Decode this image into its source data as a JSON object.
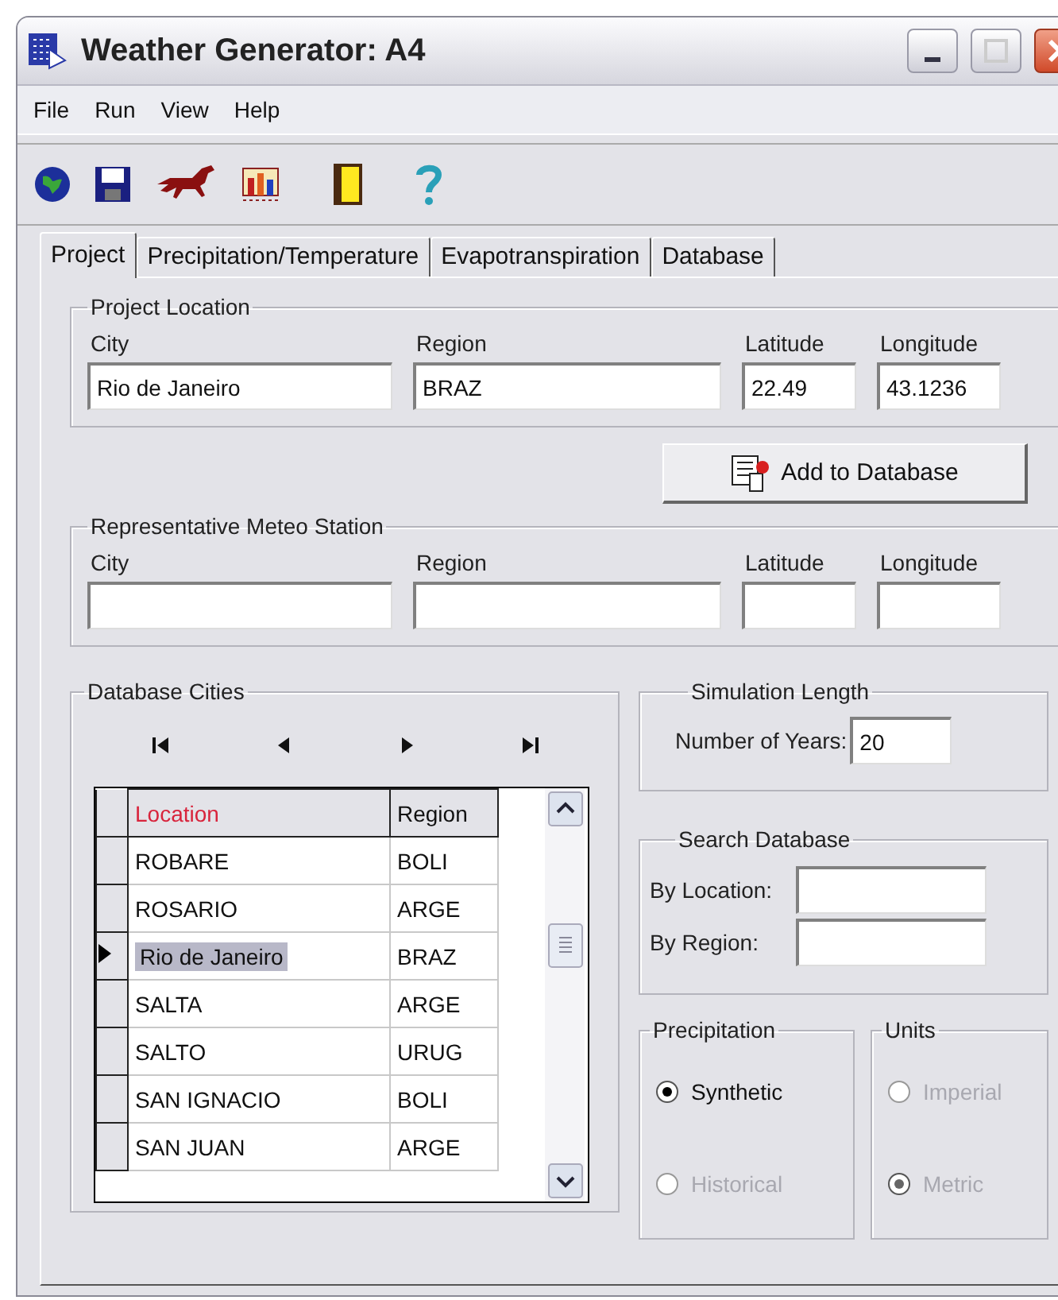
{
  "window": {
    "title": "Weather Generator: A4"
  },
  "menu": [
    "File",
    "Run",
    "View",
    "Help"
  ],
  "tabs": [
    {
      "label": "Project",
      "selected": true
    },
    {
      "label": "Precipitation/Temperature",
      "selected": false
    },
    {
      "label": "Evapotranspiration",
      "selected": false
    },
    {
      "label": "Database",
      "selected": false
    }
  ],
  "project_location": {
    "title": "Project Location",
    "fields": [
      {
        "label": "City",
        "value": "Rio de Janeiro"
      },
      {
        "label": "Region",
        "value": "BRAZ"
      },
      {
        "label": "Latitude",
        "value": "22.49"
      },
      {
        "label": "Longitude",
        "value": "43.1236"
      }
    ]
  },
  "add_button": "Add to Database",
  "meteo_station": {
    "title": "Representative Meteo Station",
    "fields": [
      {
        "label": "City"
      },
      {
        "label": "Region"
      },
      {
        "label": "Latitude"
      },
      {
        "label": "Longitude"
      }
    ]
  },
  "database_cities": {
    "title": "Database Cities",
    "columns": [
      {
        "label": "Location",
        "sorted": true
      },
      {
        "label": "Region",
        "sorted": false
      }
    ],
    "rows": [
      {
        "cells": [
          "ROBARE",
          "BOLI"
        ],
        "selected": false
      },
      {
        "cells": [
          "ROSARIO",
          "ARGE"
        ],
        "selected": false
      },
      {
        "cells": [
          "Rio de Janeiro",
          "BRAZ"
        ],
        "selected": true
      },
      {
        "cells": [
          "SALTA",
          "ARGE"
        ],
        "selected": false
      },
      {
        "cells": [
          "SALTO",
          "URUG"
        ],
        "selected": false
      },
      {
        "cells": [
          "SAN IGNACIO",
          "BOLI"
        ],
        "selected": false
      },
      {
        "cells": [
          "SAN JUAN",
          "ARGE"
        ],
        "selected": false
      }
    ]
  },
  "simulation_length": {
    "title": "Simulation Length",
    "label": "Number of Years:",
    "value": "20"
  },
  "search_database": {
    "title": "Search Database",
    "fields": [
      {
        "label": "By Location:"
      },
      {
        "label": "By Region:"
      }
    ]
  },
  "precipitation": {
    "title": "Precipitation",
    "options": [
      {
        "label": "Synthetic",
        "selected": true,
        "disabled": false
      },
      {
        "label": "Historical",
        "selected": false,
        "disabled": true
      }
    ]
  },
  "units": {
    "title": "Units",
    "options": [
      {
        "label": "Imperial",
        "selected": false,
        "disabled": true
      },
      {
        "label": "Metric",
        "selected": true,
        "disabled": true
      }
    ]
  }
}
